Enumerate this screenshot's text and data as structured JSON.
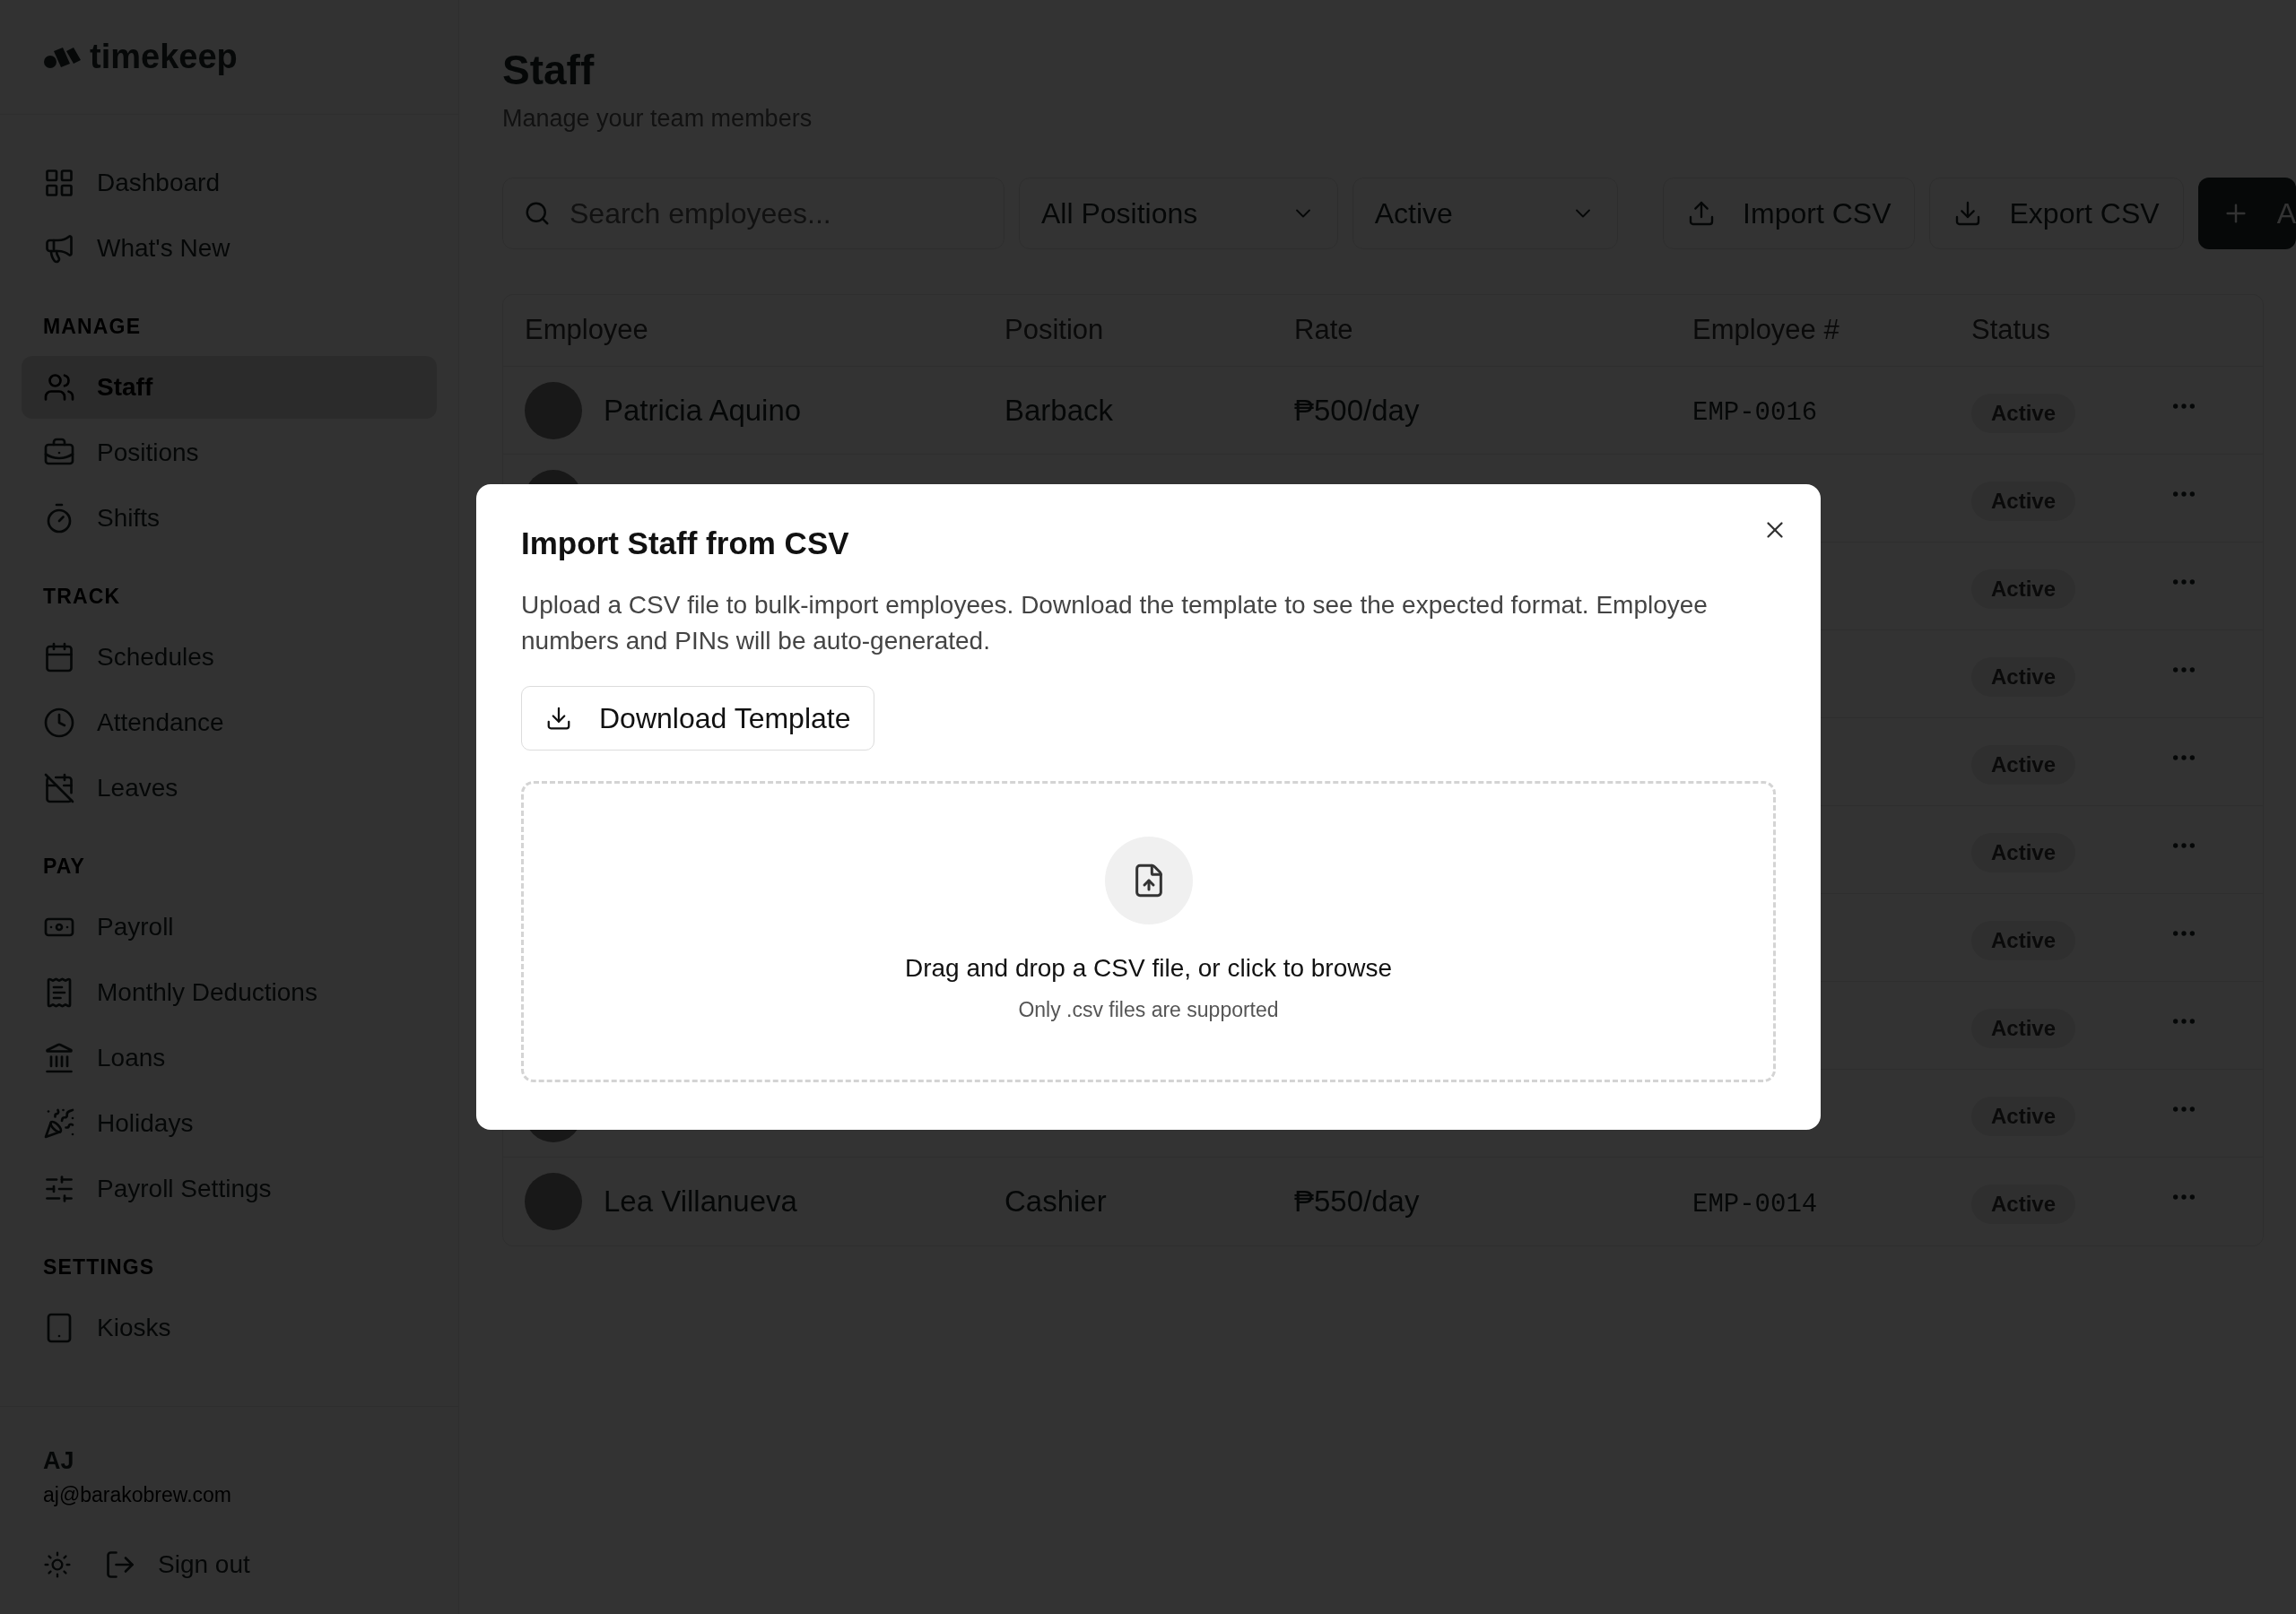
{
  "logo": "timekeep",
  "sidebar": {
    "groups": [
      {
        "items": [
          {
            "label": "Dashboard",
            "selected": false
          },
          {
            "label": "What's New",
            "selected": false
          }
        ]
      },
      {
        "heading": "MANAGE",
        "items": [
          {
            "label": "Staff",
            "selected": true
          },
          {
            "label": "Positions",
            "selected": false
          },
          {
            "label": "Shifts",
            "selected": false
          }
        ]
      },
      {
        "heading": "TRACK",
        "items": [
          {
            "label": "Schedules",
            "selected": false
          },
          {
            "label": "Attendance",
            "selected": false
          },
          {
            "label": "Leaves",
            "selected": false
          }
        ]
      },
      {
        "heading": "PAY",
        "items": [
          {
            "label": "Payroll",
            "selected": false
          },
          {
            "label": "Monthly Deductions",
            "selected": false
          },
          {
            "label": "Loans",
            "selected": false
          },
          {
            "label": "Holidays",
            "selected": false
          },
          {
            "label": "Payroll Settings",
            "selected": false
          }
        ]
      },
      {
        "heading": "SETTINGS",
        "items": [
          {
            "label": "Kiosks",
            "selected": false
          }
        ]
      }
    ]
  },
  "user": {
    "initials": "AJ",
    "email": "aj@barakobrew.com"
  },
  "sign_out": "Sign out",
  "page": {
    "title": "Staff",
    "subtitle": "Manage your team members"
  },
  "toolbar": {
    "search": {
      "placeholder": "Search employees..."
    },
    "filters": [
      "All Positions",
      "Active"
    ],
    "buttons": [
      {
        "kind": "import",
        "label": "Import CSV"
      },
      {
        "kind": "export",
        "label": "Export CSV"
      },
      {
        "kind": "add",
        "label": "A"
      }
    ]
  },
  "table": {
    "columns": [
      "Employee",
      "Position",
      "Rate",
      "Employee #",
      "Status"
    ],
    "rows": [
      {
        "name": "Patricia Aquino",
        "position": "Barback",
        "rate": "₱500/day",
        "number": "EMP-0016",
        "status": "Active"
      },
      {
        "status": "Active"
      },
      {
        "status": "Active"
      },
      {
        "status": "Active"
      },
      {
        "status": "Active"
      },
      {
        "status": "Active"
      },
      {
        "status": "Active"
      },
      {
        "status": "Active"
      },
      {
        "status": "Active"
      },
      {
        "name": "Lea Villanueva",
        "position": "Cashier",
        "rate": "₱550/day",
        "number": "EMP-0014",
        "status": "Active"
      }
    ]
  },
  "dialog": {
    "title": "Import Staff from CSV",
    "description": "Upload a CSV file to bulk-import employees. Download the template to see the expected format. Employee numbers and PINs will be auto-generated.",
    "template_button": "Download Template",
    "dropzone": {
      "text": "Drag and drop a CSV file, or click to browse",
      "hint": "Only .csv files are supported"
    }
  }
}
